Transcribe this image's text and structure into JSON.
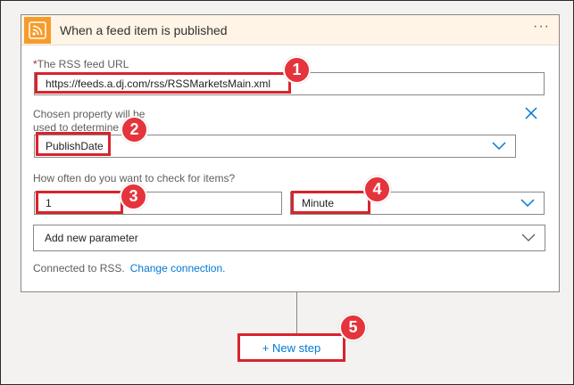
{
  "trigger": {
    "title": "When a feed item is published",
    "more_label": "···"
  },
  "feed_url": {
    "required_mark": "*",
    "label": "The RSS feed URL",
    "value": "https://feeds.a.dj.com/rss/RSSMarketsMain.xml"
  },
  "chosen_property": {
    "label_line1": "Chosen property will be",
    "label_line2": "used to determine",
    "value": "PublishDate"
  },
  "frequency": {
    "label": "How often do you want to check for items?",
    "interval_value": "1",
    "unit_value": "Minute"
  },
  "add_parameter": {
    "placeholder": "Add new parameter"
  },
  "connection": {
    "text": "Connected to RSS.",
    "link": "Change connection."
  },
  "new_step": {
    "label": "+ New step"
  },
  "callouts": [
    "1",
    "2",
    "3",
    "4",
    "5"
  ],
  "colors": {
    "accent": "#0078d4",
    "header_bg": "#fff4e5",
    "rss_icon": "#f79b29",
    "callout": "#e5343c"
  },
  "icons": [
    "rss-icon",
    "more-icon",
    "close-icon",
    "chevron-down-icon"
  ]
}
